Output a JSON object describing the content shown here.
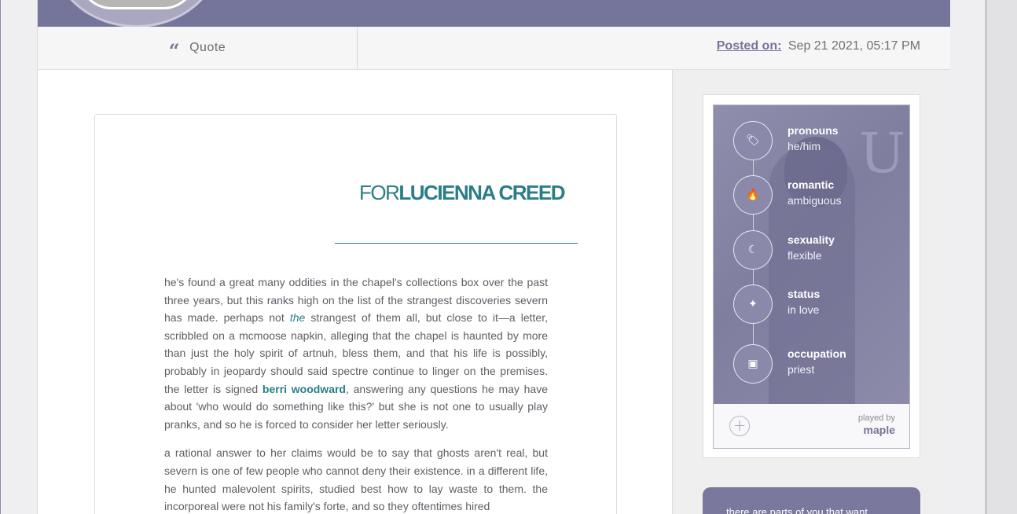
{
  "post": {
    "quote_label": "Quote",
    "posted_label": "Posted on:",
    "posted_date": "Sep 21 2021, 05:17 PM"
  },
  "content": {
    "title_prefix": "FOR",
    "title_name": "LUCIENNA CREED",
    "paragraph1": {
      "part1": "he's found a great many oddities in the chapel's collections box over the past three years, but this ranks high on the list of the strangest discoveries severn has made. perhaps not ",
      "emphasis": "the",
      "part2": " strangest of them all, but close to it—a letter, scribbled on a mcmoose napkin, alleging that the chapel is haunted by more than just the holy spirit of artnuh, bless them, and that his life is possibly, probably in jeopardy should said spectre continue to linger on the premises. the letter is signed ",
      "link": "berri woodward",
      "part3": ", answering any questions he may have about 'who would do something like this?' but she is not one to usually play pranks, and so he is forced to consider her letter seriously."
    },
    "paragraph2": "a rational answer to her claims would be to say that ghosts aren't real, but severn is one of few people who cannot deny their existence. in a different life, he hunted malevolent spirits, studied best how to lay waste to them. the incorporeal were not his family's forte, and so they oftentimes hired"
  },
  "profile": {
    "stats": [
      {
        "label": "pronouns",
        "value": "he/him",
        "icon": "tag-icon"
      },
      {
        "label": "romantic",
        "value": "ambiguous",
        "icon": "flame-icon"
      },
      {
        "label": "sexuality",
        "value": "flexible",
        "icon": "moon-icon"
      },
      {
        "label": "status",
        "value": "in love",
        "icon": "sparkle-icon"
      },
      {
        "label": "occupation",
        "value": "priest",
        "icon": "briefcase-icon"
      }
    ],
    "played_by_label": "played by",
    "player": "maple",
    "quote_text": "there are parts of you that want"
  },
  "colors": {
    "accent": "#75749a",
    "teal": "#2b7d86"
  }
}
